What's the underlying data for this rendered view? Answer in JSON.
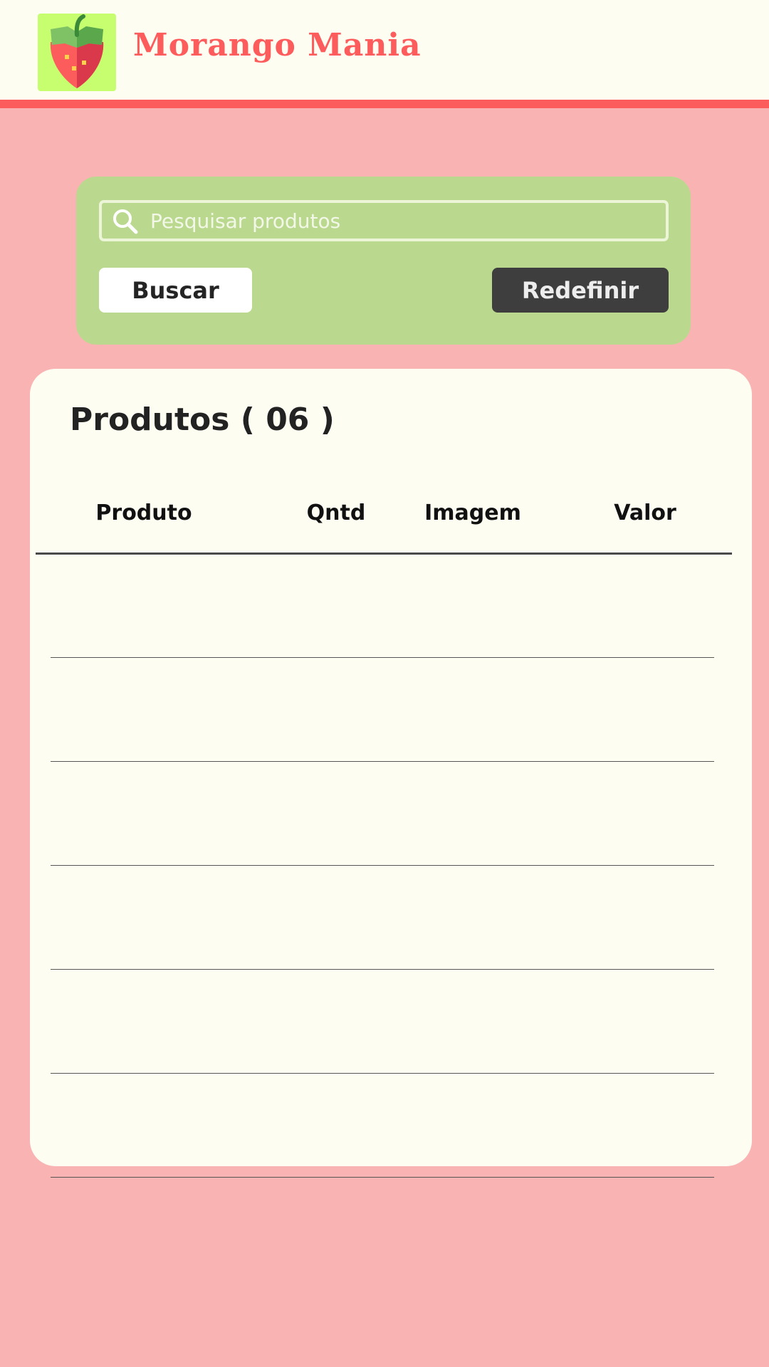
{
  "header": {
    "logo_icon": "strawberry-icon",
    "brand_name": "Morango Mania",
    "colors": {
      "background": "#fefdf1",
      "accent": "#fd5c5c",
      "logo_bg": "#c6fe70"
    }
  },
  "search": {
    "icon": "search-icon",
    "placeholder": "Pesquisar produtos",
    "value": "",
    "search_label": "Buscar",
    "reset_label": "Redefinir",
    "colors": {
      "panel": "#bad98f",
      "reset_button": "#3e3e3e"
    }
  },
  "products": {
    "title": "Produtos ( 06 )",
    "columns": [
      "Produto",
      "Qntd",
      "Imagem",
      "Valor"
    ],
    "rows": [
      {
        "produto": "",
        "qntd": "",
        "imagem": "",
        "valor": ""
      },
      {
        "produto": "",
        "qntd": "",
        "imagem": "",
        "valor": ""
      },
      {
        "produto": "",
        "qntd": "",
        "imagem": "",
        "valor": ""
      },
      {
        "produto": "",
        "qntd": "",
        "imagem": "",
        "valor": ""
      },
      {
        "produto": "",
        "qntd": "",
        "imagem": "",
        "valor": ""
      },
      {
        "produto": "",
        "qntd": "",
        "imagem": "",
        "valor": ""
      }
    ]
  },
  "page": {
    "background": "#fab3b3"
  }
}
